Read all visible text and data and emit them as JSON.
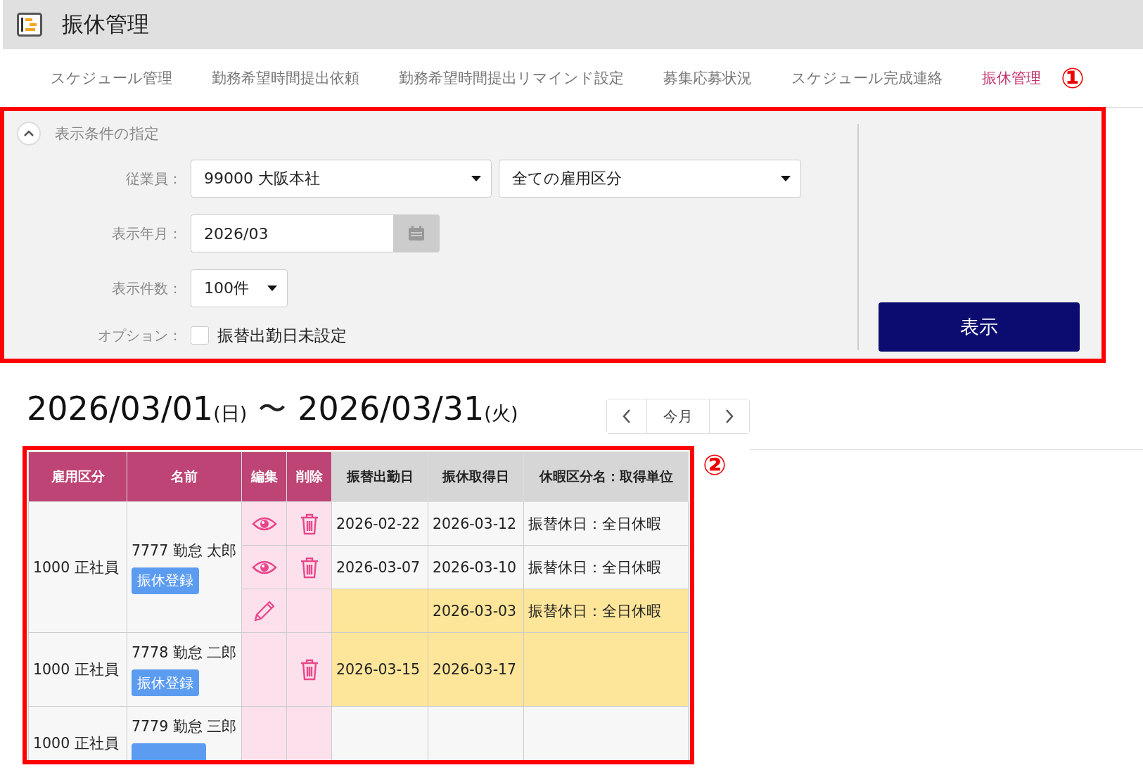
{
  "header": {
    "title": "振休管理"
  },
  "nav": [
    {
      "label": "スケジュール管理",
      "selected": false
    },
    {
      "label": "勤務希望時間提出依頼",
      "selected": false
    },
    {
      "label": "勤務希望時間提出リマインド設定",
      "selected": false
    },
    {
      "label": "募集応募状況",
      "selected": false
    },
    {
      "label": "スケジュール完成連絡",
      "selected": false
    },
    {
      "label": "振休管理",
      "selected": true
    }
  ],
  "annotations": [
    "①",
    "②"
  ],
  "filter": {
    "title": "表示条件の指定",
    "expanded": true,
    "employee_label": "従業員：",
    "employee_value": "99000 大阪本社",
    "employment_value": "全ての雇用区分",
    "month_label": "表示年月：",
    "month_value": "2026/03",
    "count_label": "表示件数：",
    "count_value": "100件",
    "option_label": "オプション：",
    "option_text": "振替出勤日未設定",
    "option_checked": false,
    "submit": "表示"
  },
  "range": {
    "start": "2026/03/01",
    "start_day": "(日)",
    "tilde": "〜",
    "end": "2026/03/31",
    "end_day": "(火)",
    "today": "今月"
  },
  "table": {
    "columns": [
      "雇用区分",
      "名前",
      "編集",
      "削除",
      "振替出勤日",
      "振休取得日",
      "休暇区分名：取得単位"
    ],
    "groups": [
      {
        "employment": "1000 正社員",
        "name": "7777 勤怠 太郎",
        "register": "振休登録",
        "rows": [
          {
            "kind": "view",
            "delete": true,
            "highlight": false,
            "work_date": "2026-02-22",
            "off_date": "2026-03-12",
            "leave_type": "振替休日：全日休暇"
          },
          {
            "kind": "view",
            "delete": true,
            "highlight": false,
            "work_date": "2026-03-07",
            "off_date": "2026-03-10",
            "leave_type": "振替休日：全日休暇"
          },
          {
            "kind": "edit",
            "delete": false,
            "highlight": true,
            "work_date": "",
            "off_date": "2026-03-03",
            "leave_type": "振替休日：全日休暇"
          }
        ]
      },
      {
        "employment": "1000 正社員",
        "name": "7778 勤怠 二郎",
        "register": "振休登録",
        "rows": [
          {
            "kind": "none",
            "delete": true,
            "highlight": true,
            "work_date": "2026-03-15",
            "off_date": "2026-03-17",
            "leave_type": ""
          }
        ]
      },
      {
        "employment": "1000 正社員",
        "name": "7779 勤怠 三郎",
        "register_partial": true,
        "rows": [
          {
            "kind": "none",
            "delete": false,
            "highlight": false,
            "work_date": "",
            "off_date": "",
            "leave_type": ""
          }
        ]
      }
    ]
  }
}
